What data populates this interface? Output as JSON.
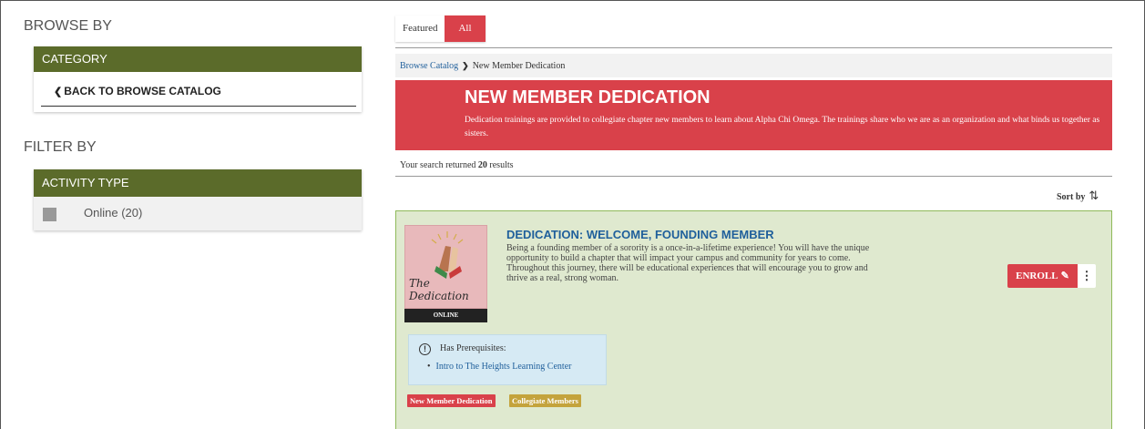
{
  "left": {
    "browse_title": "BROWSE BY",
    "category_header": "CATEGORY",
    "back_link": "BACK TO BROWSE CATALOG",
    "filter_title": "FILTER BY",
    "activity_header": "ACTIVITY TYPE",
    "activity_option": "Online (20)"
  },
  "tabs": [
    {
      "label": "Featured",
      "active": false
    },
    {
      "label": "All",
      "active": true
    }
  ],
  "breadcrumb": {
    "link": "Browse Catalog",
    "current": "New Member Dedication"
  },
  "banner": {
    "title": "NEW MEMBER DEDICATION",
    "description": "Dedication trainings are provided to collegiate chapter new members to learn about Alpha Chi Omega. The trainings share who we are as an organization and what binds us together as sisters."
  },
  "results": {
    "prefix": "Your search returned",
    "count": "20",
    "suffix": "results"
  },
  "sort_label": "Sort by",
  "course": {
    "thumbnail_text": "The Dedication",
    "thumbnail_tag": "ONLINE",
    "title": "DEDICATION: WELCOME, FOUNDING MEMBER",
    "description": "Being a founding member of a sorority is a once-in-a-lifetime experience! You will have the unique opportunity to build a chapter that will impact your campus and community for years to come. Throughout this journey, there will be educational experiences that will encourage you to grow and thrive as a real, strong woman.",
    "enroll_label": "ENROLL",
    "prereq_label": "Has Prerequisites:",
    "prereq_item": "Intro to The Heights Learning Center",
    "tags": [
      "New Member Dedication",
      "Collegiate Members"
    ]
  },
  "colors": {
    "accent_red": "#d9414a",
    "panel_green": "#5b6b2a",
    "card_bg": "#dfe9cf",
    "link_blue": "#1f5f9b",
    "tag_gold": "#c4a33c"
  }
}
